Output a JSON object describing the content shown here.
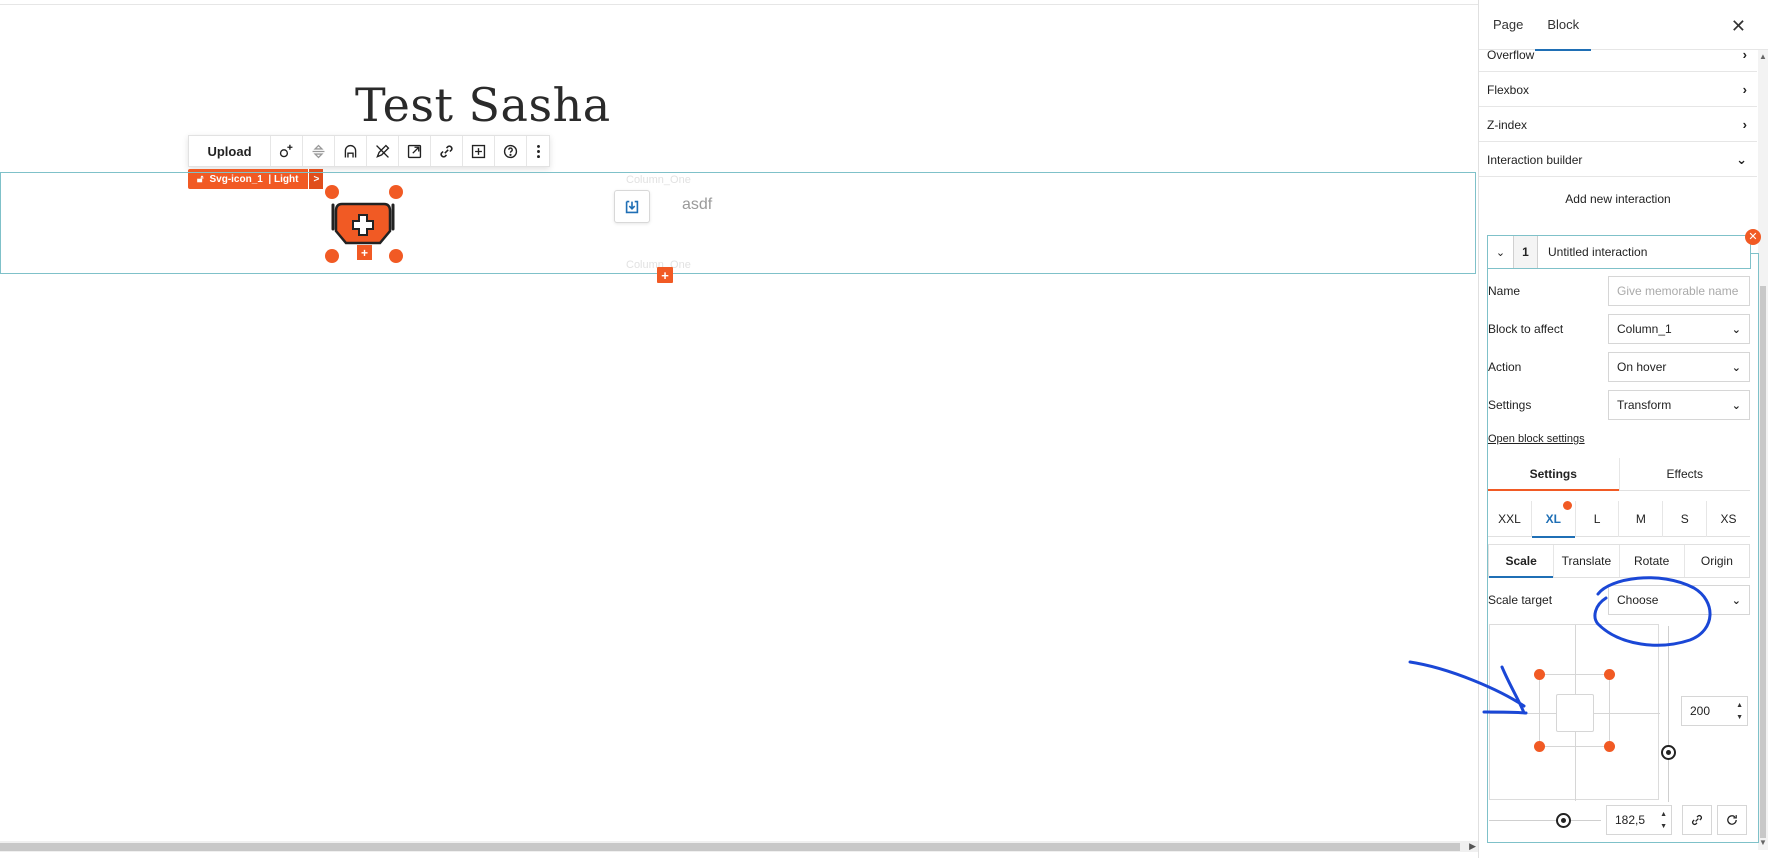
{
  "canvas": {
    "page_title": "Test Sasha",
    "toolbar": {
      "upload_label": "Upload"
    },
    "block_label": {
      "name": "Svg-icon_1",
      "style": "| Light",
      "more": ">"
    },
    "column_ghost_top": "Column_One",
    "column_ghost_bottom": "Column_One",
    "row_add": "+",
    "icon_add": "+",
    "column_text": "asdf"
  },
  "panel": {
    "tabs": [
      {
        "label": "Page"
      },
      {
        "label": "Block"
      }
    ],
    "close": "✕",
    "sections": [
      {
        "label": "Overflow"
      },
      {
        "label": "Flexbox"
      },
      {
        "label": "Z-index"
      },
      {
        "label": "Interaction builder"
      }
    ],
    "add_interaction": "Add new interaction",
    "interaction": {
      "number": "1",
      "title": "Untitled interaction",
      "remove": "✕",
      "fields": {
        "name_label": "Name",
        "name_placeholder": "Give memorable name",
        "block_label": "Block to affect",
        "block_value": "Column_1",
        "action_label": "Action",
        "action_value": "On hover",
        "settings_label": "Settings",
        "settings_value": "Transform"
      },
      "open_block_settings": "Open block settings",
      "subtabs": [
        {
          "label": "Settings"
        },
        {
          "label": "Effects"
        }
      ],
      "breakpoints": [
        {
          "label": "XXL"
        },
        {
          "label": "XL"
        },
        {
          "label": "L"
        },
        {
          "label": "M"
        },
        {
          "label": "S"
        },
        {
          "label": "XS"
        }
      ],
      "transform_tabs": [
        {
          "label": "Scale"
        },
        {
          "label": "Translate"
        },
        {
          "label": "Rotate"
        },
        {
          "label": "Origin"
        }
      ],
      "scale_target_label": "Scale target",
      "scale_target_value": "Choose",
      "scale_y": "200",
      "scale_x": "182,5"
    }
  },
  "colors": {
    "accent": "#f15a24",
    "selection": "#7fc1c9",
    "active_tab": "#1f6fb5",
    "annotation": "#1a47d6"
  }
}
